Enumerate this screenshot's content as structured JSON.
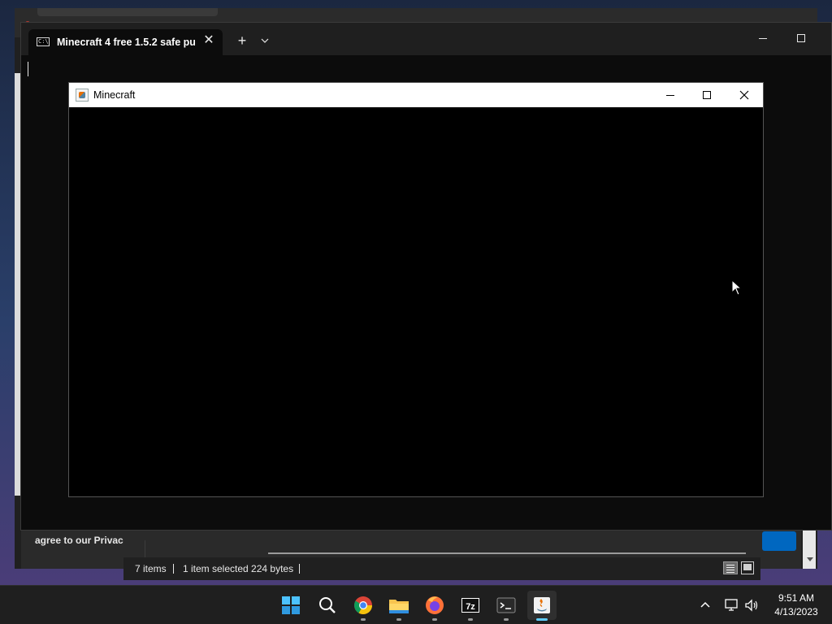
{
  "terminal": {
    "tab_title": "Minecraft 4 free 1.5.2 safe pur",
    "tab_icon_text": "C:\\",
    "tab_close_glyph": "✕",
    "new_tab_glyph": "+"
  },
  "minecraft_window": {
    "title": "Minecraft"
  },
  "browser": {
    "privacy_text": "agree to our Privac"
  },
  "explorer_status": {
    "items": "7 items",
    "selected": "1 item selected  224 bytes"
  },
  "taskbar": {
    "apps": [
      "start-icon",
      "search-icon",
      "chrome-icon",
      "file-explorer-icon",
      "firefox-icon",
      "7zip-icon",
      "terminal-icon",
      "java-icon"
    ],
    "time": "9:51 AM",
    "date": "4/13/2023"
  },
  "colors": {
    "taskbar_bg": "#1f1f1f",
    "terminal_bg": "#0c0c0c",
    "active_indicator": "#60cdff"
  }
}
